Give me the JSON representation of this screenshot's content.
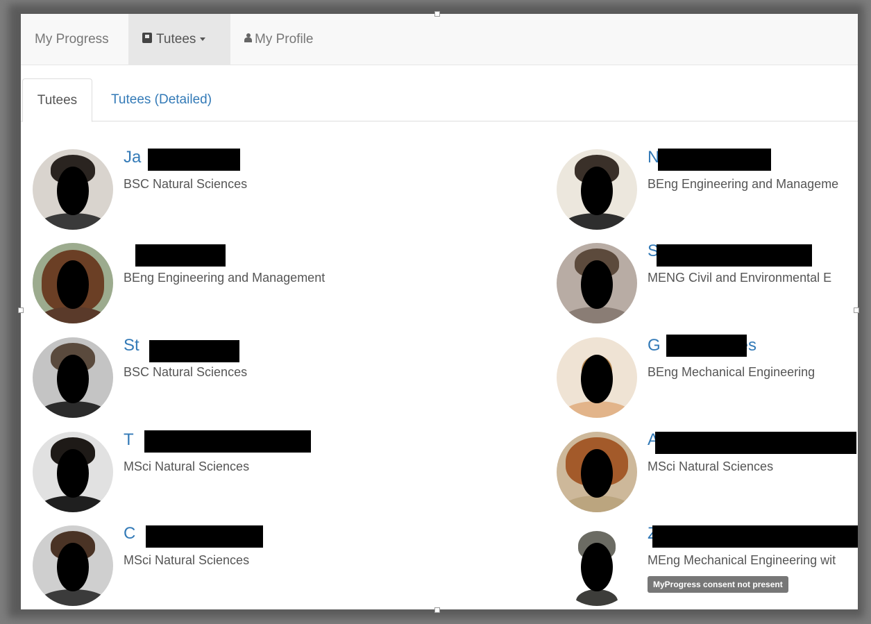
{
  "navbar": {
    "items": [
      {
        "label": "My Progress"
      },
      {
        "label": "Tutees",
        "icon": "book-icon",
        "caret": "caret-down-icon"
      },
      {
        "label": "My Profile",
        "icon": "user-icon"
      }
    ]
  },
  "tabs": [
    {
      "label": "Tutees",
      "active": true
    },
    {
      "label": "Tutees (Detailed)",
      "active": false
    }
  ],
  "tutees": [
    {
      "name_visible": "Ja",
      "name_suffix": "",
      "course": "BSC Natural Sciences",
      "badge": ""
    },
    {
      "name_visible": "N",
      "name_suffix": "",
      "course": "BEng Engineering and Manageme",
      "badge": ""
    },
    {
      "name_visible": "",
      "name_suffix": "",
      "course": "BEng Engineering and Management",
      "badge": ""
    },
    {
      "name_visible": "S",
      "name_suffix": "",
      "course": "MENG Civil and Environmental E",
      "badge": ""
    },
    {
      "name_visible": "St",
      "name_suffix": "",
      "course": "BSC Natural Sciences",
      "badge": ""
    },
    {
      "name_visible": "G",
      "name_suffix": "es",
      "course": "BEng Mechanical Engineering",
      "badge": ""
    },
    {
      "name_visible": "T",
      "name_suffix": "",
      "course": "MSci Natural Sciences",
      "badge": ""
    },
    {
      "name_visible": "A",
      "name_suffix": "",
      "course": "MSci Natural Sciences",
      "badge": ""
    },
    {
      "name_visible": "C",
      "name_suffix": "",
      "course": "MSci Natural Sciences",
      "badge": ""
    },
    {
      "name_visible": "Z",
      "name_suffix": "",
      "course": "MEng Mechanical Engineering wit",
      "badge": "MyProgress consent not present"
    }
  ],
  "colors": {
    "link": "#337ab7",
    "text": "#555555",
    "navbar_bg": "#f8f8f8",
    "badge_bg": "#777777"
  }
}
